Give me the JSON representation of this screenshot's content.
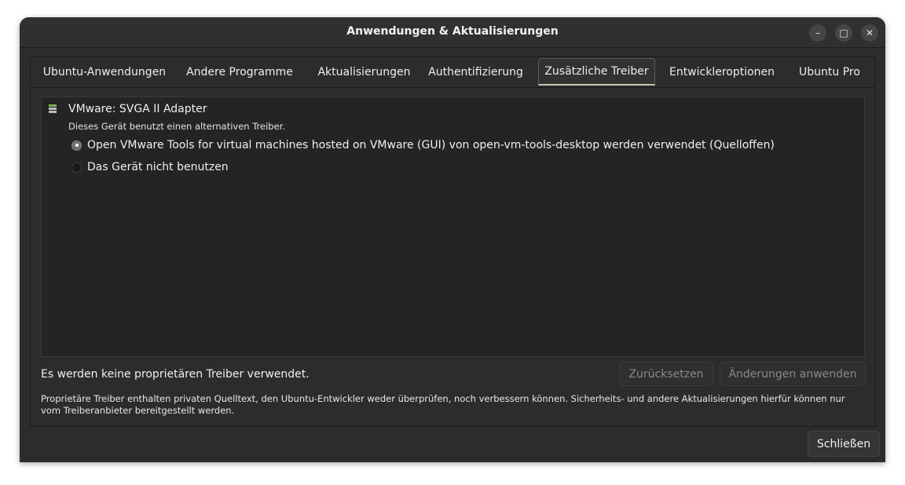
{
  "window": {
    "title": "Anwendungen & Aktualisierungen",
    "controls": {
      "minimize": "–",
      "maximize": "□",
      "close": "✕"
    }
  },
  "tabs": [
    {
      "label": "Ubuntu-Anwendungen",
      "active": false
    },
    {
      "label": "Andere Programme",
      "active": false
    },
    {
      "label": "Aktualisierungen",
      "active": false
    },
    {
      "label": "Authentifizierung",
      "active": false
    },
    {
      "label": "Zusätzliche Treiber",
      "active": true
    },
    {
      "label": "Entwickleroptionen",
      "active": false
    },
    {
      "label": "Ubuntu Pro",
      "active": false
    }
  ],
  "device": {
    "name": "VMware: SVGA II Adapter",
    "description": "Dieses Gerät benutzt einen alternativen Treiber.",
    "options": [
      {
        "label": "Open VMware Tools for virtual machines hosted on VMware (GUI) von open-vm-tools-desktop werden verwendet (Quelloffen)",
        "selected": true
      },
      {
        "label": "Das Gerät nicht benutzen",
        "selected": false
      }
    ]
  },
  "status_text": "Es werden keine proprietären Treiber verwendet.",
  "buttons": {
    "reset": "Zurücksetzen",
    "apply": "Änderungen anwenden",
    "close": "Schließen"
  },
  "note": "Proprietäre Treiber enthalten privaten Quelltext, den Ubuntu-Entwickler weder überprüfen, noch verbessern können. Sicherheits- und andere Aktualisierungen hierfür können nur vom Treiberanbieter bereitgestellt werden."
}
